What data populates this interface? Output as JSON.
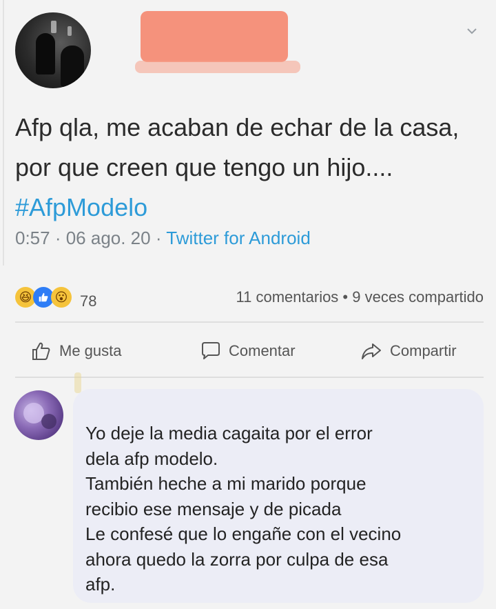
{
  "tweet": {
    "text_main": "Afp qla, me acaban de echar de la casa, por que creen que tengo un hijo.... ",
    "hashtag": "#AfpModelo",
    "time_date": "0:57 · 06 ago. 20 · ",
    "source": "Twitter for Android"
  },
  "post_stats": {
    "reaction_icons": [
      "haha-icon",
      "like-icon",
      "wow-icon"
    ],
    "reaction_count": "78",
    "comments_shares": "11 comentarios • 9 veces compartido"
  },
  "actions": {
    "like_label": "Me gusta",
    "comment_label": "Comentar",
    "share_label": "Compartir"
  },
  "comment": {
    "lines": [
      "Yo deje la media cagaita por el error",
      "dela afp modelo.",
      "También heche a mi marido porque",
      "recibio ese mensaje y de picada",
      "Le confesé que lo engañe con el vecino",
      "ahora quedo la zorra por culpa de esa",
      "afp."
    ]
  },
  "colors": {
    "hashtag": "#2d9bd8",
    "like_blue": "#2e7df6",
    "bubble_bg": "#ecedf6"
  }
}
